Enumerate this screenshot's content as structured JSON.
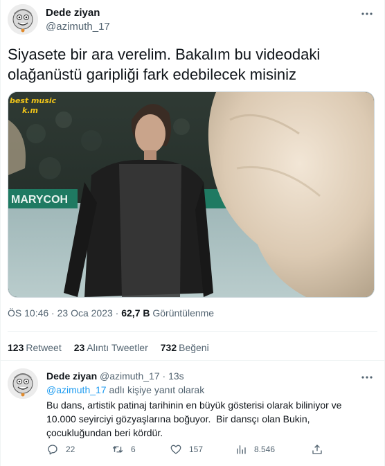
{
  "tweet": {
    "display_name": "Dede ziyan",
    "handle": "@azimuth_17",
    "text_line1": "Siyasete bir ara verelim. Bakalım bu videodaki",
    "text_line2": "olağanüstü garipliği fark edebilecek misiniz",
    "video": {
      "watermark_line1": "best music",
      "watermark_line2": "k.m",
      "banner_text": "MARYCOH"
    },
    "time": "ÖS 10:46",
    "date": "23 Oca 2023",
    "separator": "·",
    "views_count": "62,7 B",
    "views_label": "Görüntülenme",
    "retweets_count": "123",
    "retweets_label": "Retweet",
    "quotes_count": "23",
    "quotes_label": "Alıntı Tweetler",
    "likes_count": "732",
    "likes_label": "Beğeni"
  },
  "reply": {
    "display_name": "Dede ziyan",
    "handle": "@azimuth_17",
    "separator": "·",
    "time": "13s",
    "replying_mention": "@azimuth_17",
    "replying_suffix": "adlı kişiye yanıt olarak",
    "text_line1": "Bu dans, artistik patinaj tarihinin en büyük gösterisi olarak biliniyor ve",
    "text_line2": "10.000 seyirciyi gözyaşlarına boğuyor.  Bir dansçı olan Bukin,",
    "text_line3": "çocukluğundan beri kördür.",
    "replies": "22",
    "retweets": "6",
    "likes": "157",
    "views": "8.546"
  },
  "icons": {
    "more": "more-horizontal-icon",
    "reply": "speech-bubble-icon",
    "retweet": "retweet-arrows-icon",
    "like": "heart-icon",
    "views": "bar-chart-icon",
    "share": "share-upload-icon"
  },
  "colors": {
    "text": "#0f1419",
    "secondary": "#536471",
    "accent": "#1d9bf0",
    "divider": "#eff3f4"
  }
}
